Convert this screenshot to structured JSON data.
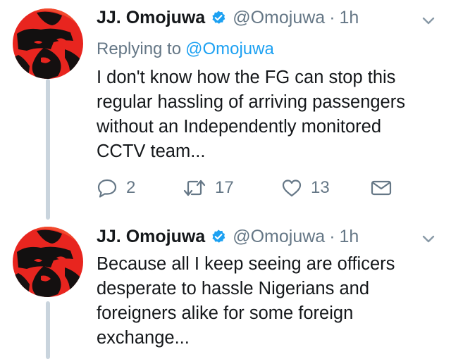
{
  "tweets": [
    {
      "display_name": "JJ. Omojuwa",
      "handle": "@Omojuwa",
      "separator": "·",
      "time": "1h",
      "replying_prefix": "Replying to",
      "replying_to": "@Omojuwa",
      "text_lines": [
        "I don't know how the FG can stop this",
        "regular hassling of arriving passengers",
        "without an Independently monitored",
        "CCTV team..."
      ],
      "replies": "2",
      "retweets": "17",
      "likes": "13"
    },
    {
      "display_name": "JJ. Omojuwa",
      "handle": "@Omojuwa",
      "separator": "·",
      "time": "1h",
      "text_lines": [
        "Because all I keep seeing are officers",
        "desperate to hassle Nigerians and",
        "foreigners alike for some foreign",
        "exchange..."
      ]
    }
  ],
  "colors": {
    "text": "#14171a",
    "secondary": "#657786",
    "link": "#1da1f2",
    "verified": "#1da1f2",
    "thread_line": "#c9d4dd",
    "avatar_red": "#e8251f"
  },
  "icons": [
    "verified-badge-icon",
    "chevron-down-icon",
    "reply-icon",
    "retweet-icon",
    "like-icon",
    "direct-message-icon"
  ]
}
